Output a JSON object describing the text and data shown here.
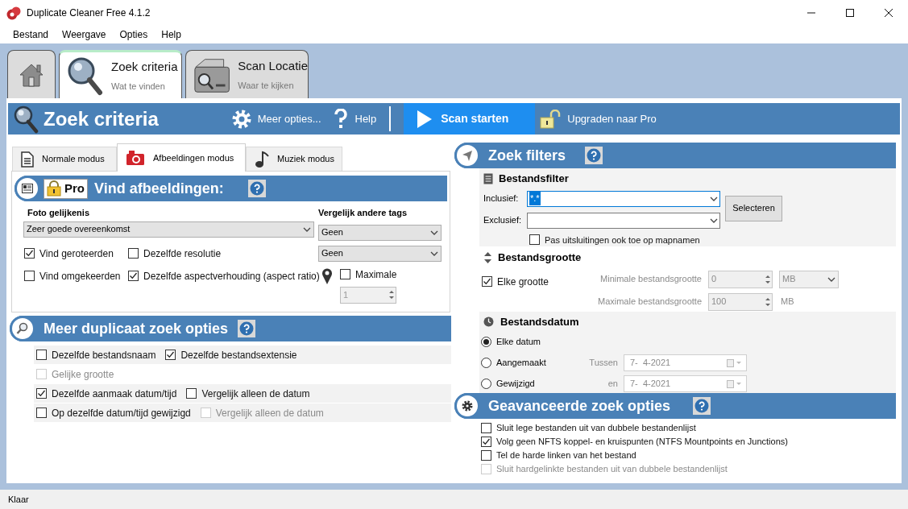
{
  "window": {
    "title": "Duplicate Cleaner Free 4.1.2"
  },
  "menu": [
    "Bestand",
    "Weergave",
    "Opties",
    "Help"
  ],
  "main_tabs": [
    {
      "kind": "home",
      "selected": false
    },
    {
      "kind": "search",
      "title": "Zoek criteria",
      "subtitle": "Wat te vinden",
      "selected": true
    },
    {
      "kind": "folder",
      "title": "Scan Locatie",
      "subtitle": "Waar te kijken",
      "selected": false
    }
  ],
  "toolbar": {
    "title": "Zoek criteria",
    "buttons": [
      {
        "kind": "gear",
        "label": "Meer opties..."
      },
      {
        "kind": "help",
        "label": "Help"
      },
      {
        "kind": "play",
        "label": "Scan starten"
      },
      {
        "kind": "lock",
        "label": "Upgraden naar Pro"
      }
    ]
  },
  "mode_tabs": [
    {
      "kind": "document",
      "label": "Normale modus",
      "selected": false
    },
    {
      "kind": "camera",
      "label": "Afbeeldingen modus",
      "selected": true
    },
    {
      "kind": "music",
      "label": "Muziek modus",
      "selected": false
    }
  ],
  "image_section": {
    "badge": "Pro",
    "title": "Vind afbeeldingen:",
    "similarity_label": "Foto gelijkenis",
    "similarity_value": "Zeer goede overeenkomst",
    "checkboxes": [
      {
        "label": "Vind geroteerden",
        "checked": true
      },
      {
        "label": "Dezelfde resolutie",
        "checked": false
      },
      {
        "label": "Vind omgekeerden",
        "checked": false
      },
      {
        "label": "Dezelfde aspectverhouding (aspect ratio)",
        "checked": true
      }
    ],
    "tags_label": "Vergelijk andere tags",
    "tag_selects": [
      "Geen",
      "Geen"
    ],
    "maximum": {
      "label": "Maximale",
      "checked": false,
      "value": "1"
    }
  },
  "more_section": {
    "title": "Meer duplicaat zoek opties",
    "rows": [
      {
        "shaded": true,
        "options": [
          {
            "label": "Dezelfde bestandsnaam",
            "checked": false,
            "disabled": false
          },
          {
            "label": "Dezelfde bestandsextensie",
            "checked": true,
            "disabled": false
          }
        ]
      },
      {
        "shaded": false,
        "options": [
          {
            "label": "Gelijke grootte",
            "checked": false,
            "disabled": true
          }
        ]
      },
      {
        "shaded": true,
        "options": [
          {
            "label": "Dezelfde aanmaak datum/tijd",
            "checked": true,
            "disabled": false
          },
          {
            "label": "Vergelijk alleen de datum",
            "checked": false,
            "disabled": false
          }
        ]
      },
      {
        "shaded": true,
        "options": [
          {
            "label": "Op dezelfde datum/tijd gewijzigd",
            "checked": false,
            "disabled": false
          },
          {
            "label": "Vergelijk alleen de datum",
            "checked": false,
            "disabled": true
          }
        ]
      }
    ]
  },
  "filters": {
    "title": "Zoek filters",
    "file_filter": {
      "title": "Bestandsfilter",
      "include_label": "Inclusief:",
      "include_value": "*.*",
      "exclude_label": "Exclusief:",
      "select_button": "Selecteren",
      "folder_option": {
        "label": "Pas uitsluitingen ook toe op mapnamen",
        "checked": false
      }
    },
    "size": {
      "title": "Bestandsgrootte",
      "any": {
        "label": "Elke grootte",
        "checked": true
      },
      "min_label": "Minimale bestandsgrootte",
      "min_value": "0",
      "min_unit": "MB",
      "max_label": "Maximale bestandsgrootte",
      "max_value": "100",
      "max_unit": "MB"
    },
    "date": {
      "title": "Bestandsdatum",
      "options": [
        {
          "label": "Elke datum",
          "selected": true
        },
        {
          "label": "Aangemaakt",
          "selected": false,
          "range_label": "Tussen",
          "date": "7-  4-2021"
        },
        {
          "label": "Gewijzigd",
          "selected": false,
          "range_label": "en",
          "date": "7-  4-2021"
        }
      ]
    }
  },
  "advanced": {
    "title": "Geavanceerde zoek opties",
    "options": [
      {
        "label": "Sluit lege bestanden uit van dubbele bestandenlijst",
        "checked": false,
        "disabled": false
      },
      {
        "label": "Volg geen NFTS koppel- en kruispunten (NTFS Mountpoints en Junctions)",
        "checked": true,
        "disabled": false
      },
      {
        "label": "Tel de harde linken van het bestand",
        "checked": false,
        "disabled": false
      },
      {
        "label": "Sluit hardgelinkte bestanden uit van dubbele bestandenlijst",
        "checked": false,
        "disabled": true
      }
    ]
  },
  "status_bar": "Klaar"
}
